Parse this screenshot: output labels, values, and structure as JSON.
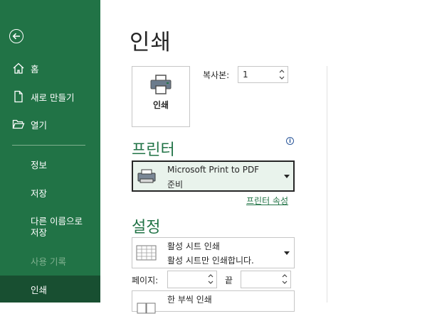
{
  "sidebar": {
    "items": [
      {
        "label": "홈"
      },
      {
        "label": "새로 만들기"
      },
      {
        "label": "열기"
      },
      {
        "label": "정보"
      },
      {
        "label": "저장"
      },
      {
        "label": "다른 이름으로\n저장"
      },
      {
        "label": "사용 기록"
      },
      {
        "label": "인쇄"
      }
    ]
  },
  "main": {
    "title": "인쇄",
    "print_button_label": "인쇄",
    "copies": {
      "label": "복사본:",
      "value": "1"
    },
    "printer_section": "프린터",
    "printer": {
      "name": "Microsoft Print to PDF",
      "status": "준비"
    },
    "printer_properties": "프린터 속성",
    "settings_section": "설정",
    "print_what": {
      "title": "활성 시트 인쇄",
      "desc": "활성 시트만 인쇄합니다."
    },
    "pages": {
      "label": "페이지:",
      "from": "",
      "end_label": "끝",
      "to": ""
    },
    "collate": {
      "title": "한 부씩 인쇄"
    }
  },
  "colors": {
    "accent": "#217346",
    "active": "#184f31"
  }
}
